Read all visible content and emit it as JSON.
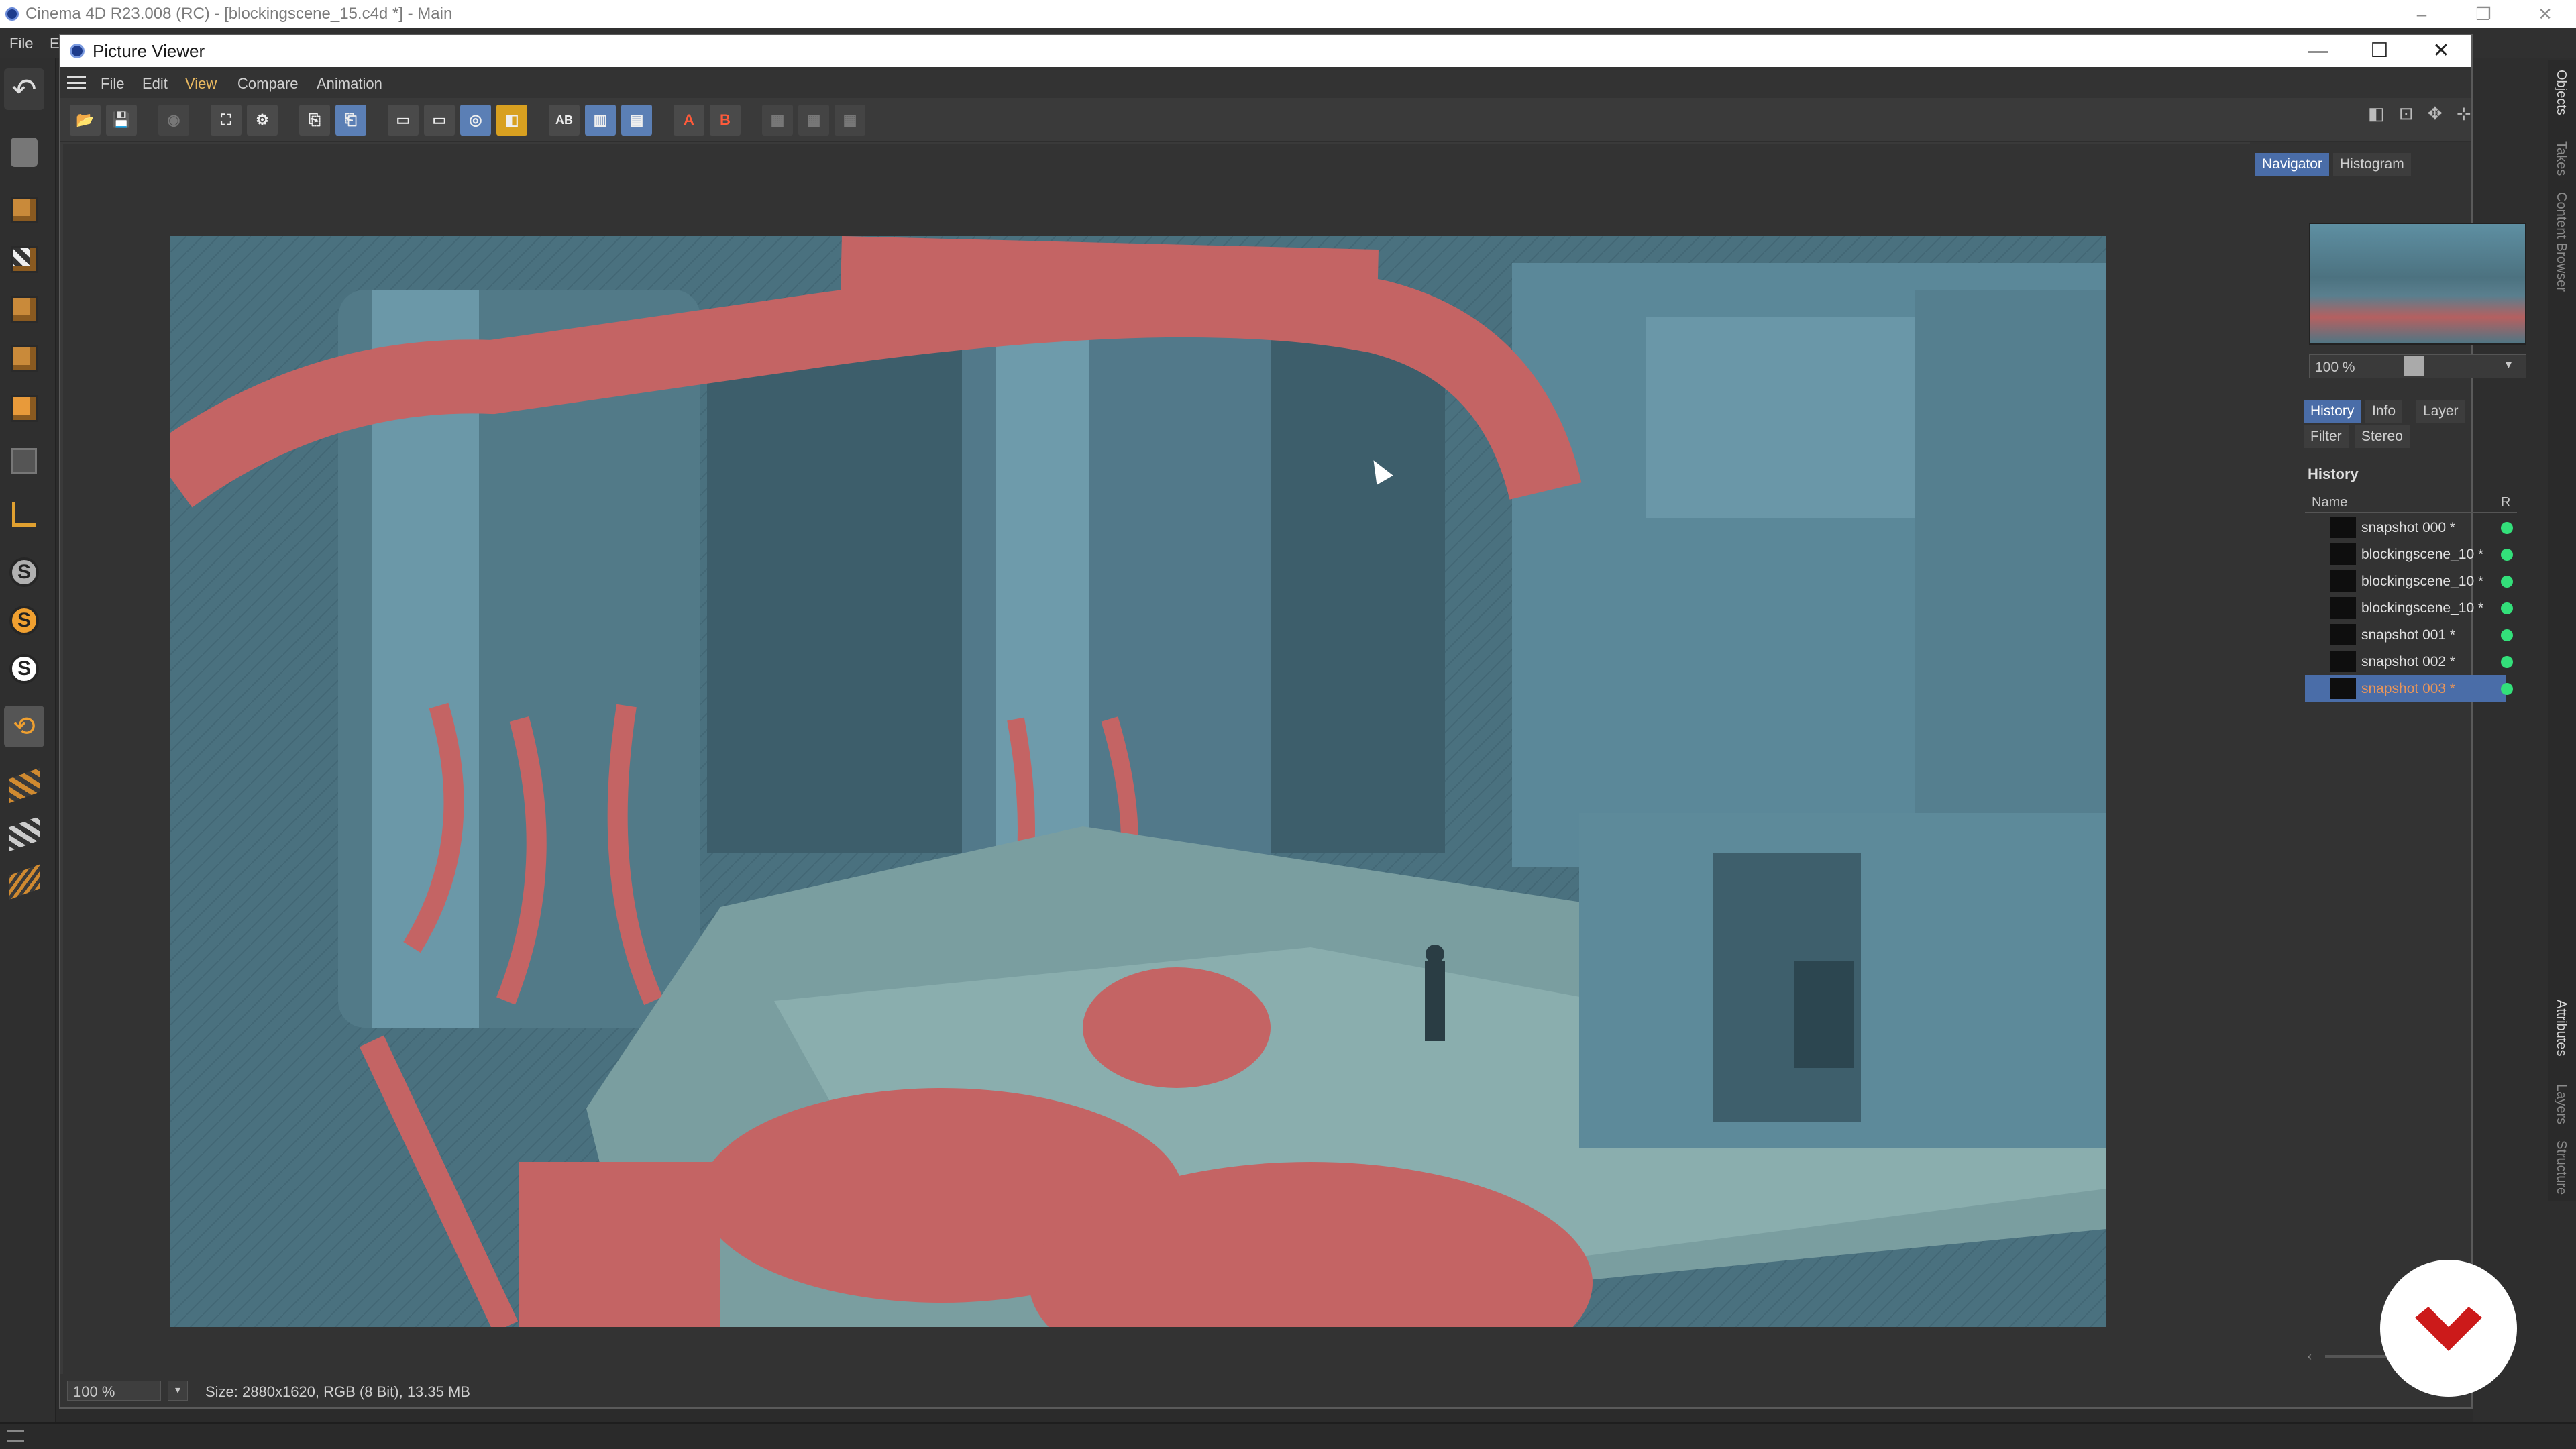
{
  "main_window": {
    "title": "Cinema 4D R23.008 (RC) - [blockingscene_15.c4d *] - Main",
    "menu": [
      "File",
      "E"
    ],
    "window_controls": [
      "–",
      "❐",
      "✕"
    ]
  },
  "right_side_tabs": [
    "Objects",
    "Takes",
    "Content Browser",
    "Attributes",
    "Layers",
    "Structure"
  ],
  "picture_viewer": {
    "title": "Picture Viewer",
    "window_controls": [
      "—",
      "☐",
      "✕"
    ],
    "menu": [
      "File",
      "Edit",
      "View",
      "Compare",
      "Animation"
    ],
    "active_menu": "View",
    "toolbar": [
      {
        "id": "open",
        "label": "📂"
      },
      {
        "id": "save",
        "label": "💾"
      },
      {
        "id": "stop",
        "label": "◉"
      },
      {
        "id": "render-region",
        "label": "⛶"
      },
      {
        "id": "render-settings",
        "label": "⚙"
      },
      {
        "id": "copy",
        "label": "⎘"
      },
      {
        "id": "paste",
        "label": "⎗"
      },
      {
        "id": "view-a",
        "label": "▭"
      },
      {
        "id": "view-b",
        "label": "▭"
      },
      {
        "id": "view-c",
        "label": "◎"
      },
      {
        "id": "view-d",
        "label": "◧"
      },
      {
        "id": "ab",
        "label": "AB"
      },
      {
        "id": "split-v",
        "label": "▥"
      },
      {
        "id": "split-h",
        "label": "▤"
      },
      {
        "id": "set-a",
        "label": "A"
      },
      {
        "id": "set-b",
        "label": "B"
      },
      {
        "id": "diff-1",
        "label": "▦"
      },
      {
        "id": "diff-2",
        "label": "▦"
      },
      {
        "id": "diff-3",
        "label": "▦"
      }
    ],
    "status": {
      "zoom": "100 %",
      "size_info": "Size: 2880x1620, RGB (8 Bit), 13.35 MB"
    },
    "panel": {
      "top_tabs": [
        "Navigator",
        "Histogram"
      ],
      "active_top_tab": "Navigator",
      "zoom_value": "100 %",
      "tabs_row1": [
        "History",
        "Info",
        "Layer"
      ],
      "tabs_row2": [
        "Filter",
        "Stereo"
      ],
      "active_tab": "History",
      "section_title": "History",
      "columns": {
        "name": "Name",
        "r": "R"
      },
      "history": [
        {
          "name": "snapshot 000 *",
          "selected": false
        },
        {
          "name": "blockingscene_10 *",
          "selected": false
        },
        {
          "name": "blockingscene_10 *",
          "selected": false
        },
        {
          "name": "blockingscene_10 *",
          "selected": false
        },
        {
          "name": "snapshot 001 *",
          "selected": false
        },
        {
          "name": "snapshot 002 *",
          "selected": false
        },
        {
          "name": "snapshot 003 *",
          "selected": true
        }
      ]
    }
  },
  "colors": {
    "accent": "#4a6da8",
    "render_blue": "#49707f",
    "render_red": "#c46464",
    "status_green": "#33e07a",
    "badge_red": "#cc1a1a"
  }
}
